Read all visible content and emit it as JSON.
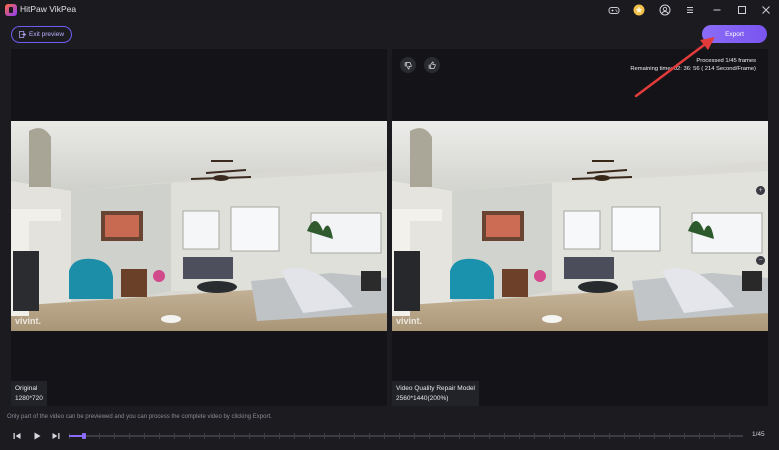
{
  "app": {
    "title": "HitPaw VikPea"
  },
  "titlebar": {
    "icons": [
      "gamepad-icon",
      "star-badge-icon",
      "user-icon",
      "menu-icon",
      "minimize-icon",
      "maximize-icon",
      "close-icon"
    ]
  },
  "header": {
    "exit_label": "Exit preview",
    "export_label": "Export"
  },
  "left_panel": {
    "label": "Original",
    "resolution": "1280*720"
  },
  "right_panel": {
    "label": "Video Quality Repair Model",
    "resolution": "2560*1440(200%)",
    "processed": "Processed 1/45 frames",
    "remaining": "Remaining time: 02: 36: 56 ( 214 Second/Frame)",
    "zoom_in": "+",
    "zoom_out": "−"
  },
  "notice": "Only part of the video can be previewed and you can process the complete video by clicking Export.",
  "player": {
    "frame_counter": "1/45",
    "progress": 0.022
  },
  "colors": {
    "accent": "#8b6cf7",
    "annotation_arrow": "#e23b3b"
  }
}
